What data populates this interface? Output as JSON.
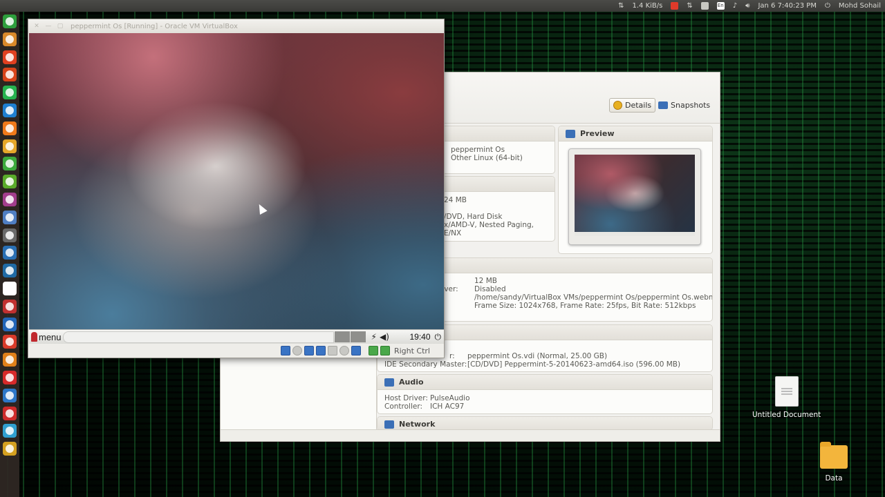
{
  "top_panel": {
    "net_speed": "1.4 KiB/s",
    "keyboard_layout": "En",
    "datetime": "Jan 6  7:40:23 PM",
    "user": "Mohd Sohail"
  },
  "launcher": {
    "icon_colors": [
      "#2e9e3c",
      "#d9892a",
      "#e04020",
      "#d8441a",
      "#26b34f",
      "#1e7fd0",
      "#f07a1a",
      "#e6a72a",
      "#3daa3d",
      "#5aab2a",
      "#a23d8c",
      "#4f7ec2",
      "#6a6a6a",
      "#2a6fb3",
      "#1f6aa5",
      "#ffffff",
      "#c03030",
      "#2265b8",
      "#d93a2a",
      "#e0801a",
      "#d72a2a",
      "#2e77c8",
      "#cf2b2b",
      "#30a0d0",
      "#d4a020"
    ]
  },
  "vm_window": {
    "title": "peppermint Os [Running] - Oracle VM VirtualBox",
    "guest_panel": {
      "menu_label": "menu",
      "clock": "19:40"
    },
    "status_bar": {
      "host_key": "Right Ctrl"
    }
  },
  "manager": {
    "tabs": {
      "details": "Details",
      "snapshots": "Snapshots"
    },
    "preview_title": "Preview",
    "general": {
      "name": "peppermint Os",
      "os_type": "Other Linux (64-bit)"
    },
    "system": {
      "memory": "24 MB",
      "boot_order": "/DVD, Hard Disk",
      "acceleration": "x/AMD-V, Nested Paging,",
      "acceleration_2": "E/NX"
    },
    "display": {
      "video_memory": "12 MB",
      "rdp_label": "rver:",
      "rdp_value": "Disabled",
      "capture_file": "/home/sandy/VirtualBox VMs/peppermint Os/peppermint Os.webm",
      "capture_attrs": "Frame Size: 1024x768, Frame Rate: 25fps, Bit Rate: 512kbps"
    },
    "storage": {
      "primary_label": "r:",
      "primary_value": "peppermint Os.vdi (Normal, 25.00 GB)",
      "secondary_label": "IDE Secondary Master:",
      "secondary_value": "[CD/DVD] Peppermint-5-20140623-amd64.iso (596.00 MB)"
    },
    "audio": {
      "title": "Audio",
      "host_driver_label": "Host Driver:",
      "host_driver": "PulseAudio",
      "controller_label": "Controller:",
      "controller": "ICH AC97"
    },
    "network": {
      "title": "Network"
    }
  },
  "desktop": {
    "icons": [
      {
        "label": "Untitled Document"
      },
      {
        "label": "Data"
      }
    ]
  }
}
